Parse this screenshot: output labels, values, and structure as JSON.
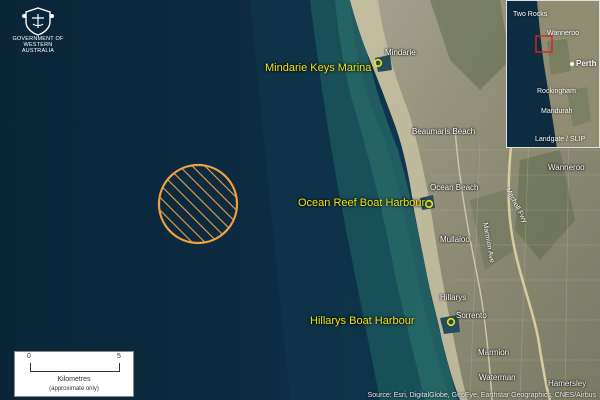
{
  "logo": {
    "line1": "GOVERNMENT OF",
    "line2": "WESTERN AUSTRALIA"
  },
  "marinas": [
    {
      "name": "Mindarie Keys Marina"
    },
    {
      "name": "Ocean Reef Boat Harbour"
    },
    {
      "name": "Hillarys Boat Harbour"
    }
  ],
  "suburbs": [
    "Mindarie",
    "Beaumaris Beach",
    "Ocean Beach",
    "Mullaloo",
    "Hillarys",
    "Sorrento",
    "Marmion",
    "Waterman",
    "Hamersley",
    "Wanneroo"
  ],
  "roads": [
    "Mitchell Fwy",
    "Marmion Ave"
  ],
  "inset": {
    "labels": [
      "Two Rocks",
      "Wanneroo",
      "Perth",
      "Rockingham",
      "Mandurah",
      "Landgate / SLIP"
    ]
  },
  "scale": {
    "start": "0",
    "end": "5",
    "unit": "Kilometres",
    "note": "(approximate only)"
  },
  "attribution": "Source: Esri, DigitalGlobe, GeoEye, Earthstar Geographics, CNES/Airbus",
  "colors": {
    "marker": "#f5e313",
    "hatch_zone": "#f0a040",
    "inset_extent": "#e02020",
    "ocean": "#0c2a3e"
  }
}
